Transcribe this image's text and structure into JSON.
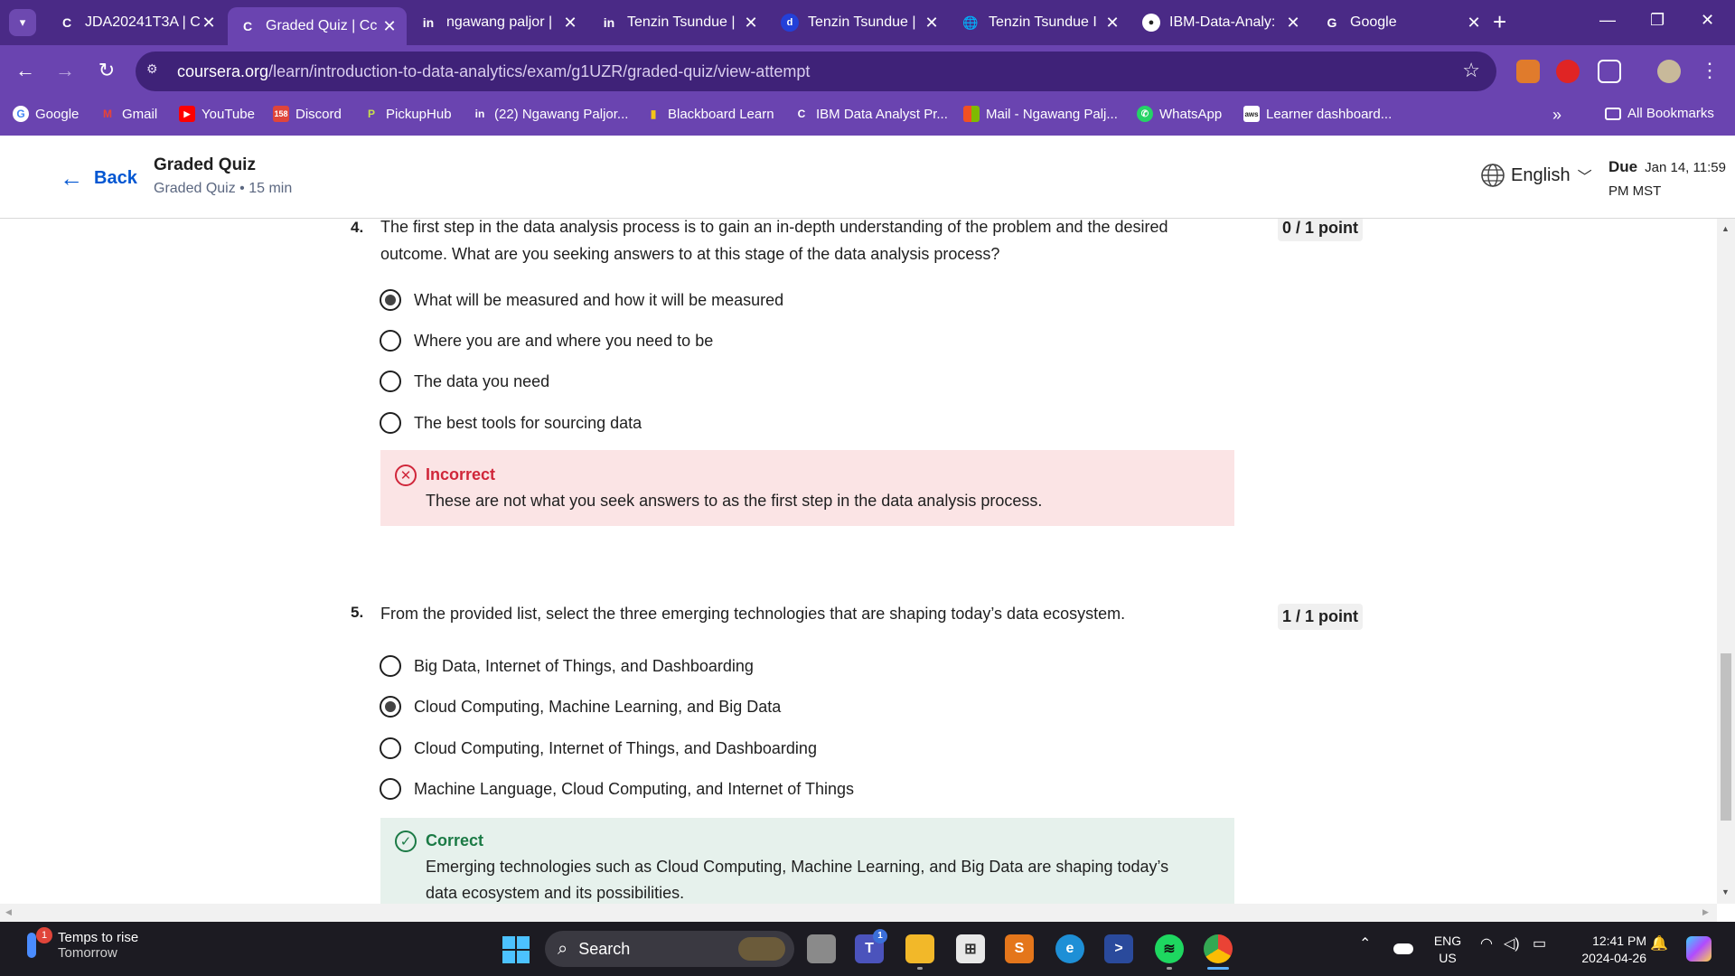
{
  "browser": {
    "tabs": [
      {
        "favicon": "coursera-icon",
        "label": "JDA20241T3A | C"
      },
      {
        "favicon": "coursera-icon",
        "label": "Graded Quiz | Cc"
      },
      {
        "favicon": "linkedin-icon",
        "label": "ngawang paljor |"
      },
      {
        "favicon": "linkedin-icon",
        "label": "Tenzin Tsundue |"
      },
      {
        "favicon": "d-icon",
        "label": "Tenzin Tsundue |"
      },
      {
        "favicon": "globe-icon",
        "label": "Tenzin Tsundue I"
      },
      {
        "favicon": "github-icon",
        "label": "IBM-Data-Analy:"
      },
      {
        "favicon": "google-icon",
        "label": "Google"
      }
    ],
    "url_host": "coursera.org",
    "url_path": "/learn/introduction-to-data-analytics/exam/g1UZR/graded-quiz/view-attempt",
    "bookmarks": [
      {
        "icon": "google-icon",
        "label": "Google"
      },
      {
        "icon": "gmail-icon",
        "label": "Gmail"
      },
      {
        "icon": "youtube-icon",
        "label": "YouTube"
      },
      {
        "icon": "discord-icon",
        "label": "Discord",
        "badge": "158"
      },
      {
        "icon": "pickuphub-icon",
        "label": "PickupHub"
      },
      {
        "icon": "linkedin-icon",
        "label": "(22) Ngawang Paljor..."
      },
      {
        "icon": "blackboard-icon",
        "label": "Blackboard Learn"
      },
      {
        "icon": "coursera-icon",
        "label": "IBM Data Analyst Pr..."
      },
      {
        "icon": "microsoft-icon",
        "label": "Mail - Ngawang Palj..."
      },
      {
        "icon": "whatsapp-icon",
        "label": "WhatsApp"
      },
      {
        "icon": "aws-icon",
        "label": "Learner dashboard..."
      }
    ],
    "all_bookmarks": "All Bookmarks"
  },
  "header": {
    "back_label": "Back",
    "title": "Graded Quiz",
    "subtitle": "Graded Quiz • 15 min",
    "language": "English",
    "due_label": "Due",
    "due_value": "Jan 14, 11:59 PM MST"
  },
  "questions": [
    {
      "number": "4.",
      "text": "The first step in the data analysis process is to gain an in-depth understanding of the problem and the desired outcome. What are you seeking answers to at this stage of the data analysis process?",
      "points": "0 / 1 point",
      "options": [
        {
          "label": "What will be measured and how it will be measured",
          "selected": true
        },
        {
          "label": "Where you are and where you need to be",
          "selected": false
        },
        {
          "label": "The data you need",
          "selected": false
        },
        {
          "label": "The best tools for sourcing data",
          "selected": false
        }
      ],
      "feedback": {
        "status": "incorrect",
        "title": "Incorrect",
        "text": "These are not what you seek answers to as the first step in the data analysis process."
      }
    },
    {
      "number": "5.",
      "text": "From the provided list, select the three emerging technologies that are shaping today’s data ecosystem.",
      "points": "1 / 1 point",
      "options": [
        {
          "label": "Big Data, Internet of Things, and Dashboarding",
          "selected": false
        },
        {
          "label": "Cloud Computing, Machine Learning, and Big Data",
          "selected": true
        },
        {
          "label": "Cloud Computing, Internet of Things, and Dashboarding",
          "selected": false
        },
        {
          "label": "Machine Language, Cloud Computing, and Internet of Things",
          "selected": false
        }
      ],
      "feedback": {
        "status": "correct",
        "title": "Correct",
        "text": "Emerging technologies such as Cloud Computing, Machine Learning, and Big Data are shaping today’s data ecosystem and its possibilities."
      }
    }
  ],
  "taskbar": {
    "weather_title": "Temps to rise",
    "weather_sub": "Tomorrow",
    "weather_badge": "1",
    "search_label": "Search",
    "teams_badge": "1",
    "lang_line1": "ENG",
    "lang_line2": "US",
    "time": "12:41 PM",
    "date": "2024-04-26"
  },
  "colors": {
    "browser_frame": "#4a2a86",
    "browser_toolbar": "#6a44b0",
    "link_blue": "#0056d2",
    "incorrect_red": "#d0263a",
    "incorrect_bg": "#fbe4e5",
    "correct_green": "#1b7a45",
    "correct_bg": "#e6f1ec"
  }
}
